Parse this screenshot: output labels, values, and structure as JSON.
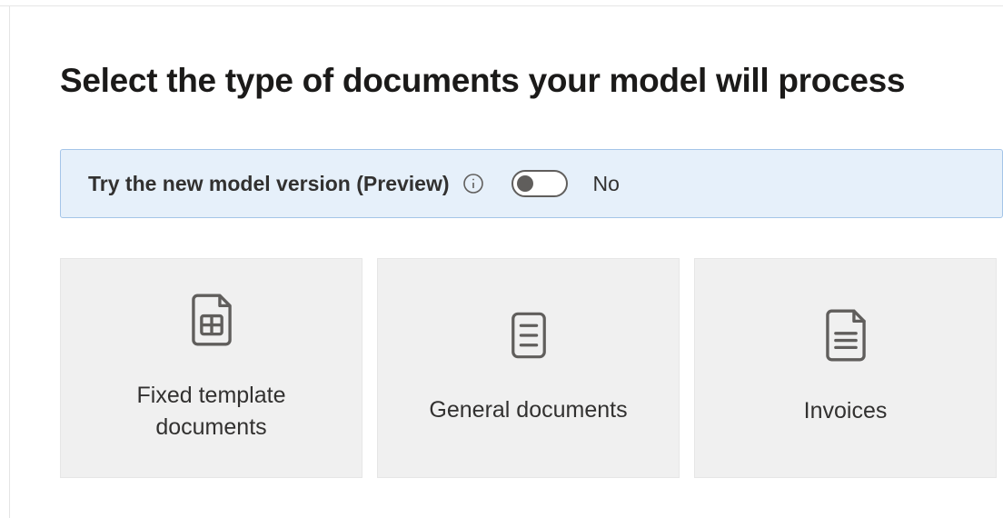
{
  "page": {
    "title": "Select the type of documents your model will process"
  },
  "preview": {
    "label": "Try the new model version (Preview)",
    "info_icon": "info-icon",
    "toggle_state": "No"
  },
  "cards": [
    {
      "icon": "table-document-icon",
      "title": "Fixed template documents"
    },
    {
      "icon": "list-document-icon",
      "title": "General documents"
    },
    {
      "icon": "lines-document-icon",
      "title": "Invoices"
    }
  ]
}
